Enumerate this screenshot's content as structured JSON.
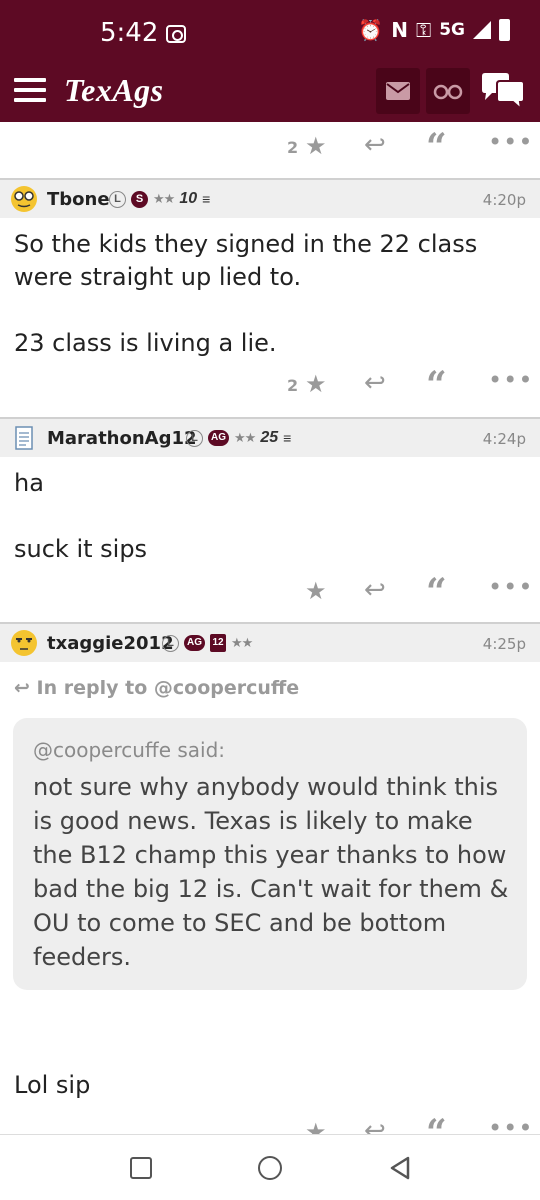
{
  "status_bar": {
    "time": "5:42",
    "network": "5G"
  },
  "header": {
    "logo": "TexAgs",
    "menu_icon": "hamburger-icon",
    "mail_icon": "mail-icon",
    "watch_icon": "binoculars-icon",
    "chat_icon": "chat-bubbles-icon"
  },
  "top_actions": {
    "star_count": "2"
  },
  "posts": [
    {
      "username": "Tbone",
      "badge_l": "L",
      "badge_second": "S",
      "stars": "★★",
      "rank": "10",
      "time": "4:20p",
      "body": "So the kids they signed in the 22 class\nwere straight up lied to.\n\n23 class is living a lie.",
      "star_count": "2"
    },
    {
      "username": "MarathonAg12",
      "badge_l": "L",
      "badge_second": "AG",
      "stars": "★★",
      "rank": "25",
      "time": "4:24p",
      "body": "ha\n\nsuck it sips",
      "star_count": ""
    },
    {
      "username": "txaggie2012",
      "badge_l": "L",
      "badge_second": "AG",
      "badge_third": "12",
      "stars": "★★",
      "time": "4:25p",
      "reply_to": "In reply to @coopercuffe",
      "quote_attr": "@coopercuffe said:",
      "quote_text": "not sure why anybody would think this is good news. Texas is likely to make the B12 champ this year thanks to how bad the big 12 is. Can't wait for them & OU to come to SEC and be bottom feeders.",
      "body": "Lol sip"
    }
  ],
  "colors": {
    "brand_maroon": "#5d0a24",
    "header_gray": "#efefef",
    "action_gray": "#9a9a9a"
  }
}
